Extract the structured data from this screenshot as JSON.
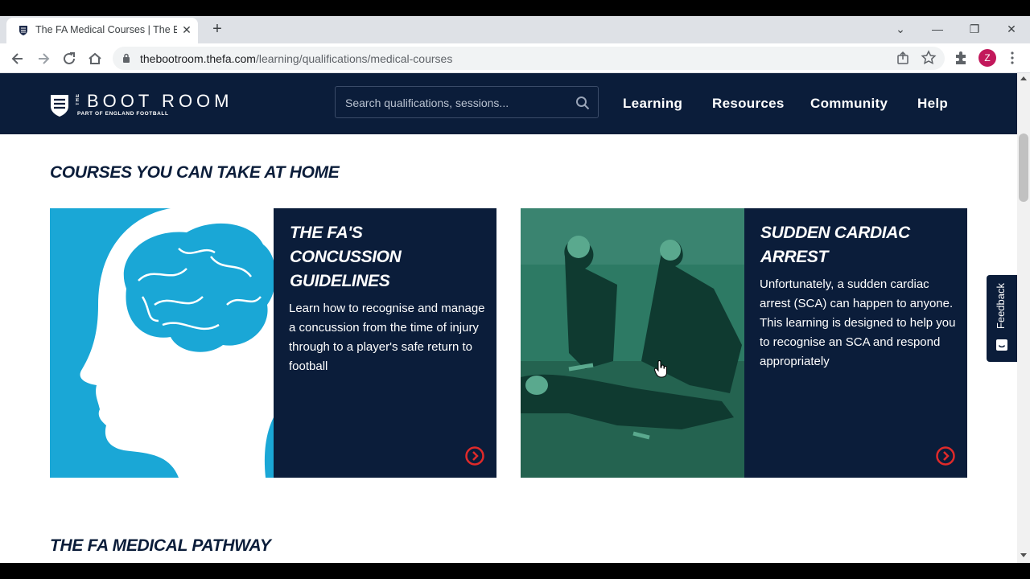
{
  "browser": {
    "tab_title": "The FA Medical Courses | The Boot Room",
    "tab_close": "✕",
    "new_tab": "+",
    "url_host": "thebootroom.thefa.com",
    "url_path": "/learning/qualifications/medical-courses",
    "profile_initial": "Z",
    "window_controls": {
      "dropdown": "⌄",
      "minimize": "—",
      "restore": "❐",
      "close": "✕"
    }
  },
  "header": {
    "logo_the": "THE",
    "logo_text": "BOOT ROOM",
    "logo_sub": "PART OF ENGLAND FOOTBALL",
    "search_placeholder": "Search qualifications, sessions...",
    "nav": [
      "Learning",
      "Resources",
      "Community",
      "Help"
    ]
  },
  "main": {
    "section_home": "COURSES YOU CAN TAKE AT HOME",
    "cards": [
      {
        "title": "THE FA'S CONCUSSION GUIDELINES",
        "description": "Learn how to recognise and manage a concussion from the time of injury through to a player's safe return to football"
      },
      {
        "title": "SUDDEN CARDIAC ARREST",
        "description": "Unfortunately, a sudden cardiac arrest (SCA) can happen to anyone. This learning is designed to help you to recognise an SCA and respond appropriately"
      }
    ],
    "section_pathway": "THE FA MEDICAL PATHWAY"
  },
  "feedback": {
    "label": "Feedback"
  },
  "colors": {
    "navy": "#0b1d3a",
    "brain_blue": "#1aa7d6",
    "accent_red": "#e02a2a",
    "photo_teal": "#1f6d5a"
  }
}
